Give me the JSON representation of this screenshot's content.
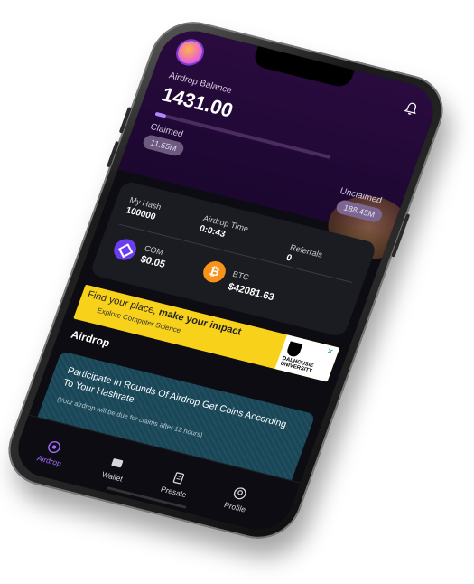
{
  "header": {
    "balance_label": "Airdrop Balance",
    "balance": "1431.00",
    "progress": 0.06,
    "claimed_label": "Claimed",
    "claimed_value": "11.55M",
    "unclaimed_label": "Unclaimed",
    "unclaimed_value": "188.45M"
  },
  "stats": {
    "hash_label": "My Hash",
    "hash_value": "100000",
    "time_label": "Airdrop Time",
    "time_value": "0:0:43",
    "referrals_label": "Referrals",
    "referrals_value": "0",
    "coins": [
      {
        "name": "COM",
        "value": "$0.05",
        "icon": "com-coin-icon"
      },
      {
        "name": "BTC",
        "value": "$42081.63",
        "icon": "btc-coin-icon"
      }
    ]
  },
  "ad": {
    "line1_prefix": "Find your place,",
    "line1_emph": "make your impact",
    "line2": "Explore Computer Science",
    "logo_text": "DALHOUSIE UNIVERSITY"
  },
  "section_title": "Airdrop",
  "airdrop_card": {
    "title": "Participate In Rounds Of Airdrop Get Coins According To Your Hashrate",
    "note": "(Your airdrop will be due for claims after 12 hours)"
  },
  "tabs": [
    {
      "label": "Airdrop",
      "icon": "airdrop-icon",
      "active": true
    },
    {
      "label": "Wallet",
      "icon": "wallet-icon",
      "active": false
    },
    {
      "label": "Presale",
      "icon": "presale-icon",
      "active": false
    },
    {
      "label": "Profile",
      "icon": "profile-icon",
      "active": false
    }
  ],
  "colors": {
    "accent": "#a46cff",
    "header_bg": "#2a0b3f",
    "ad_bg": "#f8d21a",
    "btc": "#f7931a"
  }
}
